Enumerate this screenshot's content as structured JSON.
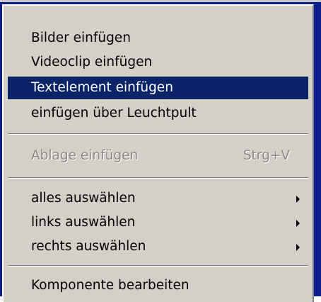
{
  "menu": {
    "items": [
      {
        "label": "Bilder einfügen"
      },
      {
        "label": "Videoclip einfügen"
      },
      {
        "label": "Textelement einfügen"
      },
      {
        "label": "einfügen über Leuchtpult"
      },
      {
        "label": "Ablage einfügen",
        "shortcut": "Strg+V"
      },
      {
        "label": "alles auswählen"
      },
      {
        "label": "links auswählen"
      },
      {
        "label": "rechts auswählen"
      },
      {
        "label": "Komponente bearbeiten"
      }
    ]
  },
  "colors": {
    "menu_background": "#d4d0c8",
    "highlight": "#0a246a",
    "disabled_text": "#8c8a85",
    "frame": "#0a1e8c"
  },
  "icons": [
    "submenu-arrow-icon"
  ]
}
